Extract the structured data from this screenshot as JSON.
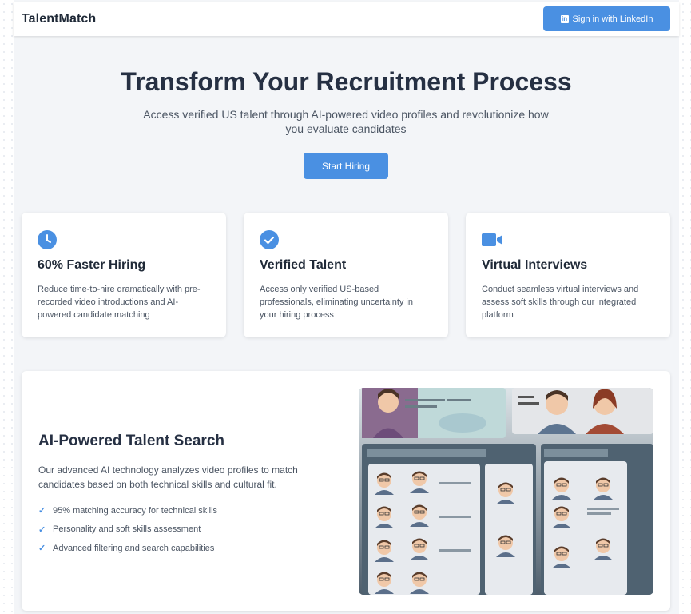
{
  "header": {
    "brand": "TalentMatch",
    "signin_label": "Sign in with LinkedIn"
  },
  "hero": {
    "title": "Transform Your Recruitment Process",
    "subtitle": "Access verified US talent through AI-powered video profiles and revolutionize how you evaluate candidates",
    "cta_label": "Start Hiring"
  },
  "features": [
    {
      "icon": "clock-icon",
      "title": "60% Faster Hiring",
      "text": "Reduce time-to-hire dramatically with pre-recorded video introductions and AI-powered candidate matching"
    },
    {
      "icon": "check-circle-icon",
      "title": "Verified Talent",
      "text": "Access only verified US-based professionals, eliminating uncertainty in your hiring process"
    },
    {
      "icon": "video-camera-icon",
      "title": "Virtual Interviews",
      "text": "Conduct seamless virtual interviews and assess soft skills through our integrated platform"
    }
  ],
  "ai_section": {
    "title": "AI-Powered Talent Search",
    "description": "Our advanced AI technology analyzes video profiles to match candidates based on both technical skills and cultural fit.",
    "bullets": [
      "95% matching accuracy for technical skills",
      "Personality and soft skills assessment",
      "Advanced filtering and search capabilities"
    ]
  },
  "colors": {
    "accent": "#4a90e2",
    "heading": "#263043",
    "background": "#f3f5f8"
  }
}
